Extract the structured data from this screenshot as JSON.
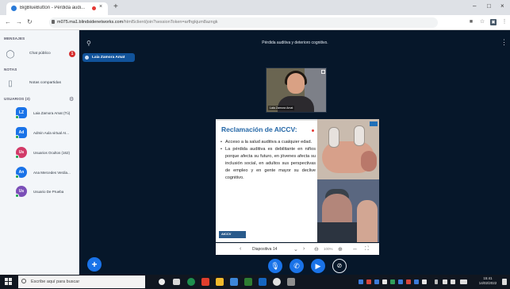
{
  "browser": {
    "tab_title": "BigBlueButton - Pérdida audi...",
    "tab_close": "×",
    "new_tab": "+",
    "url_host": "m075.ma1.blindsidenetworks.com",
    "url_rest": "/html5client/join?sessionToken=arfhgkjum8azngk",
    "window_controls": [
      "–",
      "□",
      "×"
    ]
  },
  "sidebar": {
    "messages_header": "MENSAJES",
    "public_chat": "Chat público",
    "public_chat_badge": "1",
    "notes_header": "NOTAS",
    "shared_notes": "Notas compartidas",
    "users_header": "USUARIOS (3)",
    "users": [
      {
        "initials": "LZ",
        "name": "Laia Zamora Amat (Tú)",
        "color": "#1a73e8"
      },
      {
        "initials": "Ad",
        "name": "Admin Aula virtual AI...",
        "color": "#1a73e8"
      },
      {
        "initials": "Us",
        "name": "Usuarios Ocultos (162)",
        "color": "#d23a68"
      },
      {
        "initials": "An",
        "name": "Ana Mercedes Verdia...",
        "color": "#1a73e8"
      },
      {
        "initials": "Us",
        "name": "Usuario De Prueba",
        "color": "#7b4fb8"
      }
    ]
  },
  "main": {
    "title": "Pérdida auditiva y deterioro cognitivo.",
    "presenter": "Laia Zamora Amat",
    "webcam_name": "Laia Zamora Amat"
  },
  "slide": {
    "title": "Reclamación de AICCV:",
    "bullet1": "Acceso a la salud auditiva a cualquier edad.",
    "bullet2": "La pérdida auditiva es debilitante en niños porque afecta su futuro, en jóvenes afecta su inclusión social, en adultos sus perspectivas de empleo y en gente mayor su declive cognitivo.",
    "logo": "AICCV"
  },
  "slide_controls": {
    "slide_label": "Diapositiva 14",
    "zoom": "100%"
  },
  "taskbar": {
    "search_placeholder": "Escribe aquí para buscar",
    "time": "15:41",
    "date": "14/02/2022"
  }
}
